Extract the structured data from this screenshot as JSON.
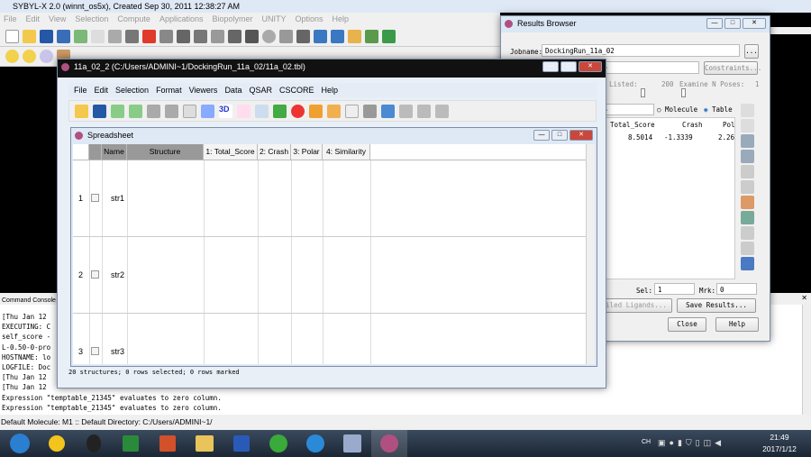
{
  "main": {
    "title": "SYBYL-X 2.0 (winnt_os5x), Created Sep 30, 2011 12:38:27 AM",
    "menu": [
      "File",
      "Edit",
      "View",
      "Selection",
      "Compute",
      "Applications",
      "Biopolymer",
      "UNITY",
      "Options",
      "Help"
    ]
  },
  "console": {
    "title": "Command Console",
    "lines": [
      "[Thu Jan 12",
      "EXECUTING: C",
      "self_score -",
      "L-0.50-0-pro",
      "HOSTNAME: lo",
      "LOGFILE: Doc",
      "[Thu Jan 12",
      "[Thu Jan 12",
      "Expression \"temptable_21345\" evaluates to zero column.",
      "Expression \"temptable_21345\" evaluates to zero column."
    ]
  },
  "status_bar": "Default Molecule: M1 :: Default Directory: C:/Users/ADMINI~1/",
  "results": {
    "title": "Results Browser",
    "jobname_label": "Jobname:",
    "jobname": "DockingRun_11a_02",
    "browse": "...",
    "constraints": "Constraints...",
    "listed_label": "Listed:",
    "listed_value": "200",
    "poses_label": "Examine N Poses:",
    "poses_value": "1",
    "molecule": "Molecule",
    "table": "Table",
    "columns": [
      "Total_Score",
      "Crash",
      "Pol"
    ],
    "row": [
      "8.5014",
      "-1.3339",
      "2.26"
    ],
    "sel_label": "Sel:",
    "sel": "1",
    "mrk_label": "Mrk:",
    "mrk": "0",
    "failed": "iled Ligands...",
    "save": "Save Results...",
    "close": "Close",
    "help": "Help"
  },
  "table_window": {
    "title": "11a_02_2 (C:/Users/ADMINI~1/DockingRun_11a_02/11a_02.tbl)",
    "menu": [
      "File",
      "Edit",
      "Selection",
      "Format",
      "Viewers",
      "Data",
      "QSAR",
      "CSCORE",
      "Help"
    ],
    "spreadsheet_title": "Spreadsheet",
    "headers": [
      "Name",
      "Structure",
      "1: Total_Score",
      "2: Crash",
      "3: Polar",
      "4: Similarity"
    ],
    "rows": [
      {
        "num": "1",
        "name": "str1"
      },
      {
        "num": "2",
        "name": "str2"
      },
      {
        "num": "3",
        "name": "str3"
      }
    ],
    "status": "20 structures; 0 rows selected; 0 rows marked"
  },
  "taskbar": {
    "lang": "CH",
    "time": "21:49",
    "date": "2017/1/12"
  }
}
